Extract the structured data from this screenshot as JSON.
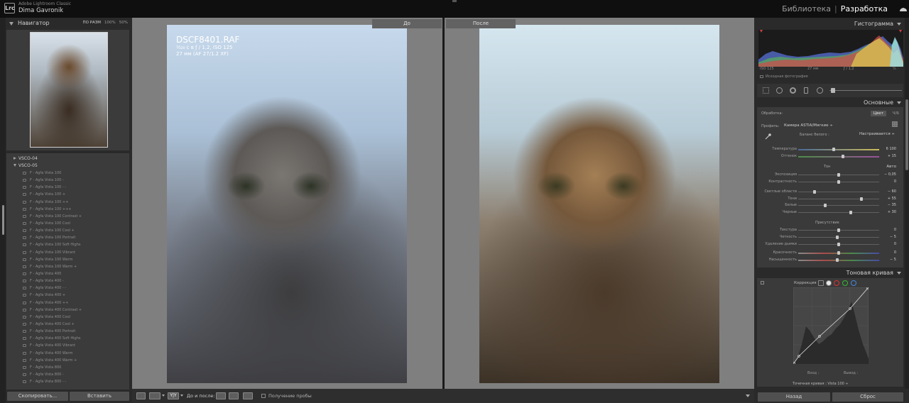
{
  "app": {
    "app_name": "Adobe Lightroom Classic",
    "user_name": "Dima Gavronik",
    "logo_text": "Lrc",
    "modules": {
      "library": "Библиотека",
      "separator": "|",
      "develop": "Разработка"
    }
  },
  "navigator": {
    "title": "Навигатор",
    "zoom_fit": "ПО РАЗМ",
    "zoom_100": "100%",
    "zoom_50": "50%"
  },
  "presets": {
    "groups": [
      "VSCO-04",
      "VSCO-05"
    ],
    "items": [
      "F - Agfa Vista 100",
      "F - Agfa Vista 100 -",
      "F - Agfa Vista 100 - -",
      "F - Agfa Vista 100 +",
      "F - Agfa Vista 100 ++",
      "F - Agfa Vista 100 +++",
      "F - Agfa Vista 100 Contrast +",
      "F - Agfa Vista 100 Cool",
      "F - Agfa Vista 100 Cool +",
      "F - Agfa Vista 100 Portrait",
      "F - Agfa Vista 100 Soft Highs",
      "F - Agfa Vista 100 Vibrant",
      "F - Agfa Vista 100 Warm",
      "F - Agfa Vista 100 Warm +",
      "F - Agfa Vista 400",
      "F - Agfa Vista 400 -",
      "F - Agfa Vista 400 - -",
      "F - Agfa Vista 400 +",
      "F - Agfa Vista 400 ++",
      "F - Agfa Vista 400 Contrast +",
      "F - Agfa Vista 400 Cool",
      "F - Agfa Vista 400 Cool +",
      "F - Agfa Vista 400 Portrait",
      "F - Agfa Vista 400 Soft Highs",
      "F - Agfa Vista 400 Vibrant",
      "F - Agfa Vista 400 Warm",
      "F - Agfa Vista 400 Warm +",
      "F - Agfa Vista 800",
      "F - Agfa Vista 800 -",
      "F - Agfa Vista 800 - -"
    ]
  },
  "left_buttons": {
    "copy": "Скопировать...",
    "paste": "Вставить"
  },
  "compare": {
    "before_label": "До",
    "after_label": "После",
    "filename": "DSCF8401.RAF",
    "exposure": "¹⁄₁₂₀ с в ƒ / 1,2, ISO 125",
    "lens": "27 мм (AF 27/1.2 XF)"
  },
  "toolbar": {
    "yy_label": "Y|Y",
    "before_after": "До и после:",
    "soft_proofing": "Получение пробы"
  },
  "histogram": {
    "title": "Гистограмма",
    "iso": "ISO 125",
    "focal": "27 мм",
    "aperture": "ƒ / 1,2",
    "shutter": "¹⁄₁",
    "original_photo": "Исходная фотография"
  },
  "basic": {
    "title": "Основные",
    "processing": "Обработка:",
    "color": "Цвет",
    "bw": "Ч/Б",
    "profile_label": "Профиль:",
    "profile_value": "Камера ASTIA/Мягкие ÷",
    "wb_label": "Баланс белого :",
    "wb_value": "Настраивается ÷",
    "tone_label": "Тон",
    "auto": "Авто",
    "presence_label": "Присутствие",
    "sliders": [
      {
        "label": "Температура",
        "value": "6 100",
        "pos": 0.44,
        "track": "temp"
      },
      {
        "label": "Оттенок",
        "value": "+ 15",
        "pos": 0.55,
        "track": "tint"
      },
      {
        "label": "Экспозиция",
        "value": "− 0,05",
        "pos": 0.5,
        "track": ""
      },
      {
        "label": "Контрастность",
        "value": "0",
        "pos": 0.5,
        "track": ""
      },
      {
        "label": "Светлые области",
        "value": "− 60",
        "pos": 0.2,
        "track": ""
      },
      {
        "label": "Тени",
        "value": "+ 55",
        "pos": 0.78,
        "track": ""
      },
      {
        "label": "Белые",
        "value": "− 35",
        "pos": 0.33,
        "track": ""
      },
      {
        "label": "Черные",
        "value": "+ 30",
        "pos": 0.65,
        "track": ""
      },
      {
        "label": "Текстура",
        "value": "0",
        "pos": 0.5,
        "track": ""
      },
      {
        "label": "Четкость",
        "value": "− 5",
        "pos": 0.48,
        "track": ""
      },
      {
        "label": "Удаление дымки",
        "value": "0",
        "pos": 0.5,
        "track": ""
      },
      {
        "label": "Красочность",
        "value": "0",
        "pos": 0.5,
        "track": "sat"
      },
      {
        "label": "Насыщенность",
        "value": "− 5",
        "pos": 0.48,
        "track": "sat"
      }
    ]
  },
  "tone_curve": {
    "title": "Тоновая кривая",
    "correction": "Коррекция :",
    "input": "Вход :",
    "output": "Вывод :",
    "preset": "Точечная кривая : Vista 100 ÷"
  },
  "right_buttons": {
    "back": "Назад",
    "reset": "Сброс"
  }
}
